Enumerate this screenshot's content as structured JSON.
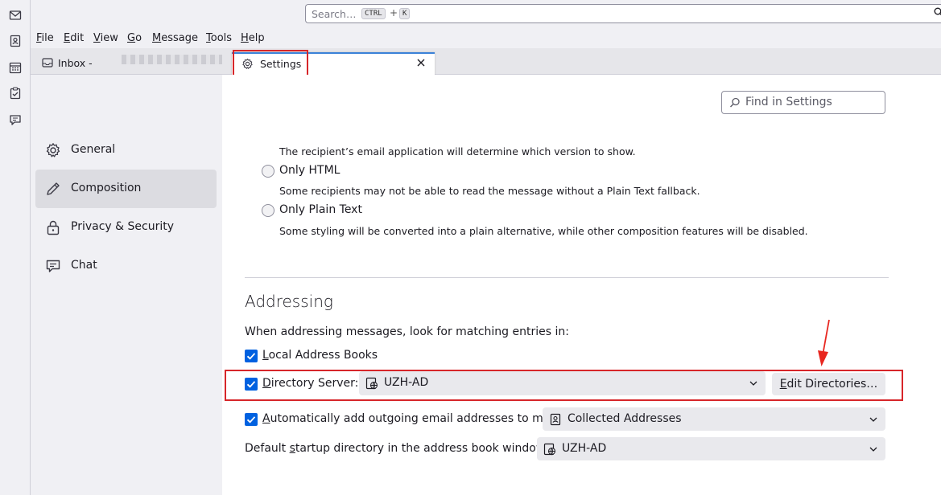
{
  "search": {
    "placeholder": "Search…",
    "key_ctrl": "CTRL",
    "key_plus": "+",
    "key_k": "K"
  },
  "menubar": [
    {
      "label": "File",
      "key": "F",
      "rest": "ile"
    },
    {
      "label": "Edit",
      "key": "E",
      "rest": "dit"
    },
    {
      "label": "View",
      "key": "V",
      "rest": "iew"
    },
    {
      "label": "Go",
      "key": "G",
      "rest": "o"
    },
    {
      "label": "Message",
      "key": "M",
      "rest": "essage"
    },
    {
      "label": "Tools",
      "key": "T",
      "rest": "ools"
    },
    {
      "label": "Help",
      "key": "H",
      "rest": "elp"
    }
  ],
  "tabs": {
    "inbox_label": "Inbox -",
    "settings_label": "Settings"
  },
  "nav": {
    "items": [
      {
        "label": "General",
        "icon": "gear-icon"
      },
      {
        "label": "Composition",
        "icon": "pencil-icon",
        "selected": true
      },
      {
        "label": "Privacy & Security",
        "icon": "lock-icon"
      },
      {
        "label": "Chat",
        "icon": "chat-icon"
      }
    ]
  },
  "find": {
    "placeholder": "Find in Settings"
  },
  "composition": {
    "recipient_note": "The recipient’s email application will determine which version to show.",
    "only_html": "Only HTML",
    "only_html_note": "Some recipients may not be able to read the message without a Plain Text fallback.",
    "only_plain": "Only Plain Text",
    "only_plain_note": "Some styling will be converted into a plain alternative, while other composition features will be disabled."
  },
  "addressing": {
    "heading": "Addressing",
    "intro": "When addressing messages, look for matching entries in:",
    "local_books": {
      "key": "L",
      "rest": "ocal Address Books",
      "checked": true
    },
    "directory_server": {
      "key": "D",
      "rest": "irectory Server:",
      "checked": true,
      "value": "UZH-AD"
    },
    "edit_directories": {
      "key": "E",
      "rest": "dit Directories…"
    },
    "auto_add": {
      "key": "A",
      "rest": "utomatically add outgoing email addresses to my:",
      "checked": true,
      "value": "Collected Addresses"
    },
    "default_startup": {
      "pre": "Default ",
      "key": "s",
      "rest": "tartup directory in the address book window:",
      "value": "UZH-AD"
    }
  },
  "colors": {
    "accent": "#0061e0",
    "highlight_box": "#d7262a",
    "tab_active_border": "#3b82d8"
  }
}
